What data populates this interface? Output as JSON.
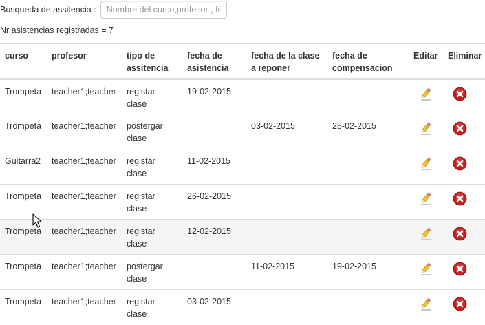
{
  "search": {
    "label": "Busqueda de assitencia :",
    "placeholder": "Nombre del curso,profesor , fecha",
    "value": ""
  },
  "count_text": "Nr asistencias registradas = 7",
  "table": {
    "headers": {
      "curso": "curso",
      "profesor": "profesor",
      "tipo_line1": "tipo de",
      "tipo_line2": "assitencia",
      "fecha_line1": "fecha de",
      "fecha_line2": "asistencia",
      "clase_line1": "fecha de la clase",
      "clase_line2": "a reponer",
      "comp_line1": "fecha de",
      "comp_line2": "compensacion",
      "editar": "Editar",
      "eliminar": "Eliminar"
    },
    "rows": [
      {
        "curso": "Trompeta",
        "profesor": "teacher1;teacher",
        "tipo1": "registar",
        "tipo2": "clase",
        "fecha": "19-02-2015",
        "clase": "",
        "comp": ""
      },
      {
        "curso": "Trompeta",
        "profesor": "teacher1;teacher",
        "tipo1": "postergar",
        "tipo2": "clase",
        "fecha": "",
        "clase": "03-02-2015",
        "comp": "28-02-2015"
      },
      {
        "curso": "Guitarra2",
        "profesor": "teacher1;teacher",
        "tipo1": "registar",
        "tipo2": "clase",
        "fecha": "11-02-2015",
        "clase": "",
        "comp": ""
      },
      {
        "curso": "Trompeta",
        "profesor": "teacher1;teacher",
        "tipo1": "registar",
        "tipo2": "clase",
        "fecha": "26-02-2015",
        "clase": "",
        "comp": ""
      },
      {
        "curso": "Trompeta",
        "profesor": "teacher1;teacher",
        "tipo1": "registar",
        "tipo2": "clase",
        "fecha": "12-02-2015",
        "clase": "",
        "comp": ""
      },
      {
        "curso": "Trompeta",
        "profesor": "teacher1;teacher",
        "tipo1": "postergar",
        "tipo2": "clase",
        "fecha": "",
        "clase": "11-02-2015",
        "comp": "19-02-2015"
      },
      {
        "curso": "Trompeta",
        "profesor": "teacher1;teacher",
        "tipo1": "registar",
        "tipo2": "clase",
        "fecha": "03-02-2015",
        "clase": "",
        "comp": ""
      }
    ],
    "hover_row": 4,
    "row_icons": {
      "edit": "pencil-icon",
      "delete": "delete-x-icon"
    }
  },
  "colors": {
    "delete_red": "#c41e1e",
    "pencil_yellow": "#f0c030",
    "border": "#dddddd",
    "hover_bg": "#f5f5f5"
  }
}
